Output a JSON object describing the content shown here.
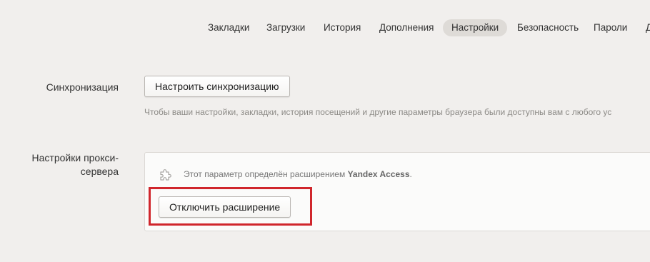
{
  "nav": {
    "tabs": [
      {
        "label": "Закладки"
      },
      {
        "label": "Загрузки"
      },
      {
        "label": "История"
      },
      {
        "label": "Дополнения"
      },
      {
        "label": "Настройки",
        "active": true
      },
      {
        "label": "Безопасность"
      },
      {
        "label": "Пароли"
      },
      {
        "label": "Д"
      }
    ]
  },
  "sync": {
    "label": "Синхронизация",
    "button_label": "Настроить синхронизацию",
    "hint": "Чтобы ваши настройки, закладки, история посещений и другие параметры браузера были доступны вам с любого ус"
  },
  "proxy": {
    "label": "Настройки прокси-сервера",
    "ext_text_prefix": "Этот параметр определён расширением ",
    "ext_name": "Yandex Access",
    "ext_text_suffix": ".",
    "button_label": "Отключить расширение",
    "icon": "puzzle-piece-icon"
  },
  "colors": {
    "background": "#f1efed",
    "active_tab": "#dedbd7",
    "highlight": "#d0262c",
    "hint_text": "#8c8a86"
  }
}
